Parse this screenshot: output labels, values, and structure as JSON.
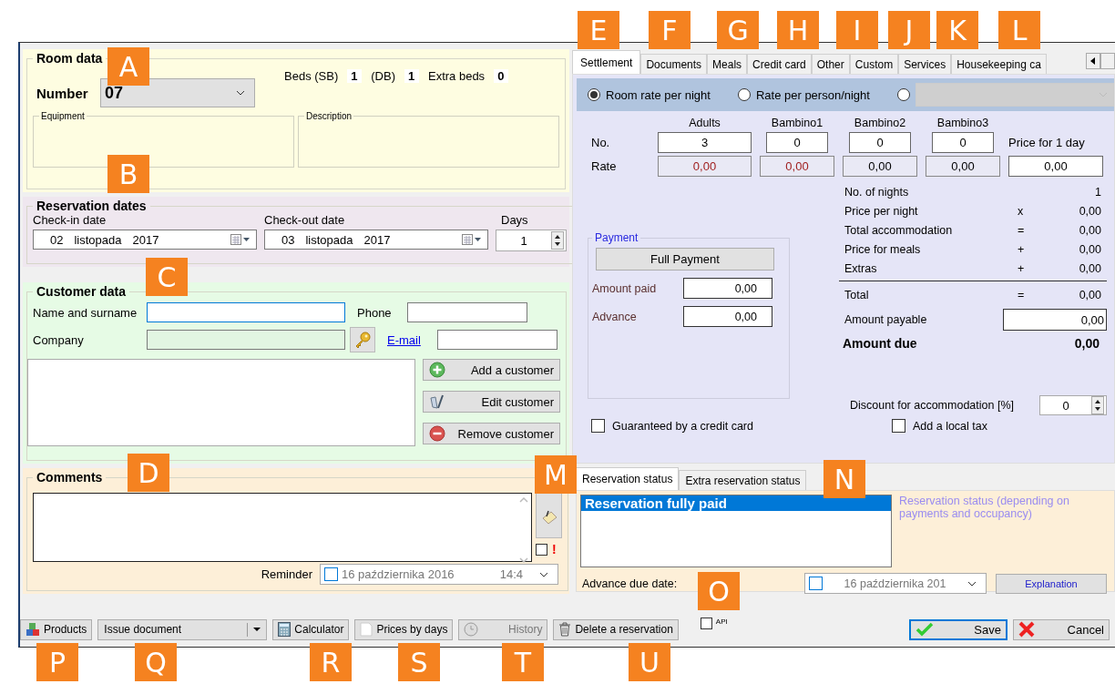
{
  "callouts": [
    "A",
    "B",
    "C",
    "D",
    "E",
    "F",
    "G",
    "H",
    "I",
    "J",
    "K",
    "L",
    "M",
    "N",
    "O",
    "P",
    "Q",
    "R",
    "S",
    "T",
    "U"
  ],
  "room": {
    "title": "Room data",
    "number_label": "Number",
    "number": "07",
    "beds_sb_label": "Beds (SB)",
    "beds_sb": "1",
    "db_label": "(DB)",
    "db": "1",
    "extra_label": "Extra beds",
    "extra": "0",
    "equipment_label": "Equipment",
    "description_label": "Description"
  },
  "dates": {
    "title": "Reservation dates",
    "checkin_label": "Check-in date",
    "checkin": {
      "day": "02",
      "month": "listopada",
      "year": "2017"
    },
    "checkout_label": "Check-out date",
    "checkout": {
      "day": "03",
      "month": "listopada",
      "year": "2017"
    },
    "days_label": "Days",
    "days": "1"
  },
  "customer": {
    "title": "Customer data",
    "name_label": "Name and surname",
    "company_label": "Company",
    "phone_label": "Phone",
    "email_link": "E-mail",
    "buttons": [
      {
        "label": "Add a customer",
        "kind": "add"
      },
      {
        "label": "Edit customer",
        "kind": "edit"
      },
      {
        "label": "Remove customer",
        "kind": "remove"
      }
    ]
  },
  "comments": {
    "title": "Comments",
    "flag_checked": false,
    "alert_mark": "!",
    "reminder_label": "Reminder",
    "reminder_checked": false,
    "reminder_date": "16 października 2016",
    "reminder_time": "14:4"
  },
  "tabs": [
    {
      "label": "Settlement",
      "selected": true
    },
    {
      "label": "Documents",
      "selected": false
    },
    {
      "label": "Meals",
      "selected": false
    },
    {
      "label": "Credit card",
      "selected": false
    },
    {
      "label": "Other",
      "selected": false
    },
    {
      "label": "Custom",
      "selected": false
    },
    {
      "label": "Services",
      "selected": false
    },
    {
      "label": "Housekeeping ca",
      "selected": false
    }
  ],
  "rate_modes": [
    {
      "label": "Room rate per night",
      "selected": true
    },
    {
      "label": "Rate per person/night",
      "selected": false
    },
    {
      "selected": false
    }
  ],
  "rate_combo": {
    "disabled": true
  },
  "guests": {
    "no_label": "No.",
    "rate_label": "Rate",
    "price_label": "Price for 1 day",
    "price": "0,00",
    "columns": [
      {
        "label": "Adults",
        "no": "3",
        "rate": "0,00",
        "warning": true
      },
      {
        "label": "Bambino1",
        "no": "0",
        "rate": "0,00",
        "warning": true
      },
      {
        "label": "Bambino2",
        "no": "0",
        "rate": "0,00",
        "warning": false
      },
      {
        "label": "Bambino3",
        "no": "0",
        "rate": "0,00",
        "warning": false
      }
    ]
  },
  "summary": [
    {
      "label": "No. of nights",
      "value": "1"
    },
    {
      "label": "Price per night",
      "op": "x",
      "value": "0,00"
    },
    {
      "label": "Total accommodation",
      "op": "=",
      "value": "0,00"
    },
    {
      "label": "Price for meals",
      "op": "+",
      "value": "0,00"
    },
    {
      "label": "Extras",
      "op": "+",
      "value": "0,00"
    },
    {
      "label": "Total",
      "op": "=",
      "value": "0,00"
    }
  ],
  "amount_payable_label": "Amount payable",
  "amount_payable": "0,00",
  "amount_due_label": "Amount due",
  "amount_due": "0,00",
  "payment": {
    "title": "Payment",
    "full_button": "Full Payment",
    "amount_paid_label": "Amount paid",
    "amount_paid": "0,00",
    "advance_label": "Advance",
    "advance": "0,00"
  },
  "discount_label": "Discount for accommodation [%]",
  "discount": "0",
  "guaranteed": {
    "label": "Guaranteed by a credit card",
    "checked": false
  },
  "local_tax": {
    "label": "Add a local tax",
    "checked": false
  },
  "status_tabs": [
    {
      "label": "Reservation status",
      "selected": true
    },
    {
      "label": "Extra reservation status",
      "selected": false
    }
  ],
  "status_list": [
    {
      "label": "Reservation fully paid",
      "selected": true
    }
  ],
  "status_hint": "Reservation status (depending on payments and occupancy)",
  "advance_due_label": "Advance due date:",
  "advance_due_checked": false,
  "advance_due_date": "16 października 201",
  "explanation_button": "Explanation",
  "toolbar": {
    "products": "Products",
    "issue_document": "Issue document",
    "calculator": "Calculator",
    "prices_by_days": "Prices by days",
    "history": "History",
    "history_disabled": true,
    "delete": "Delete a reservation",
    "api_label": "API",
    "api_checked": false,
    "save": "Save",
    "cancel": "Cancel"
  }
}
